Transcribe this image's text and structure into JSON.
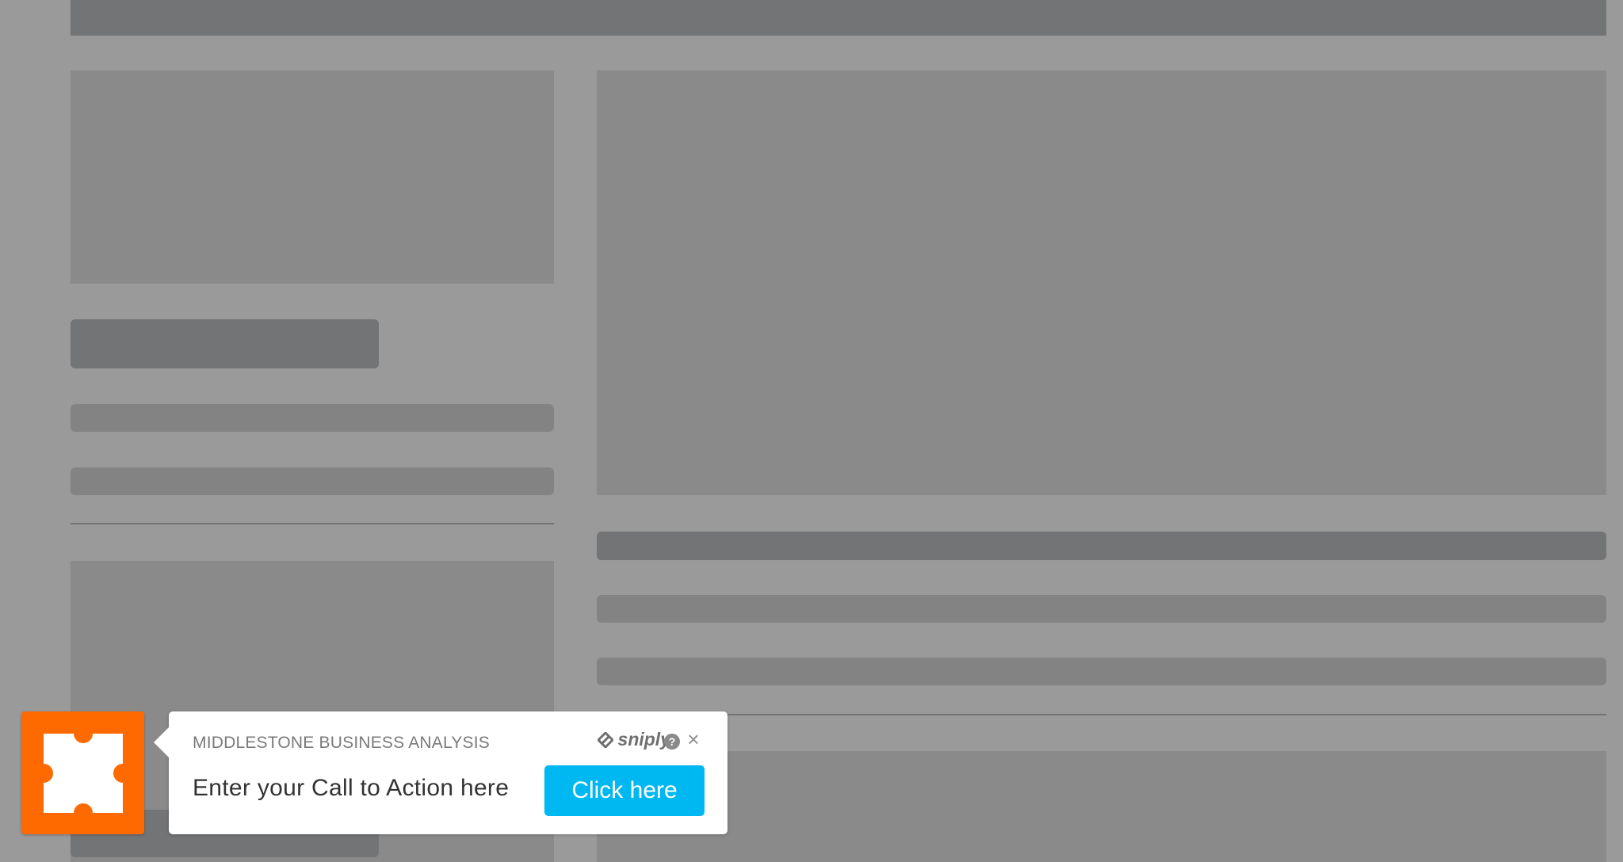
{
  "sniply": {
    "source": "MIDDLESTONE BUSINESS ANALYSIS",
    "brand": "sniply",
    "help_glyph": "?",
    "close_glyph": "×",
    "message": "Enter your Call to Action here",
    "button_label": "Click here",
    "logo_color": "#ff6a00",
    "button_color": "#00b8f1"
  },
  "icons": {
    "logo": "puzzle-icon",
    "brand": "sniply-logo-icon",
    "help": "help-icon",
    "close": "close-icon"
  }
}
